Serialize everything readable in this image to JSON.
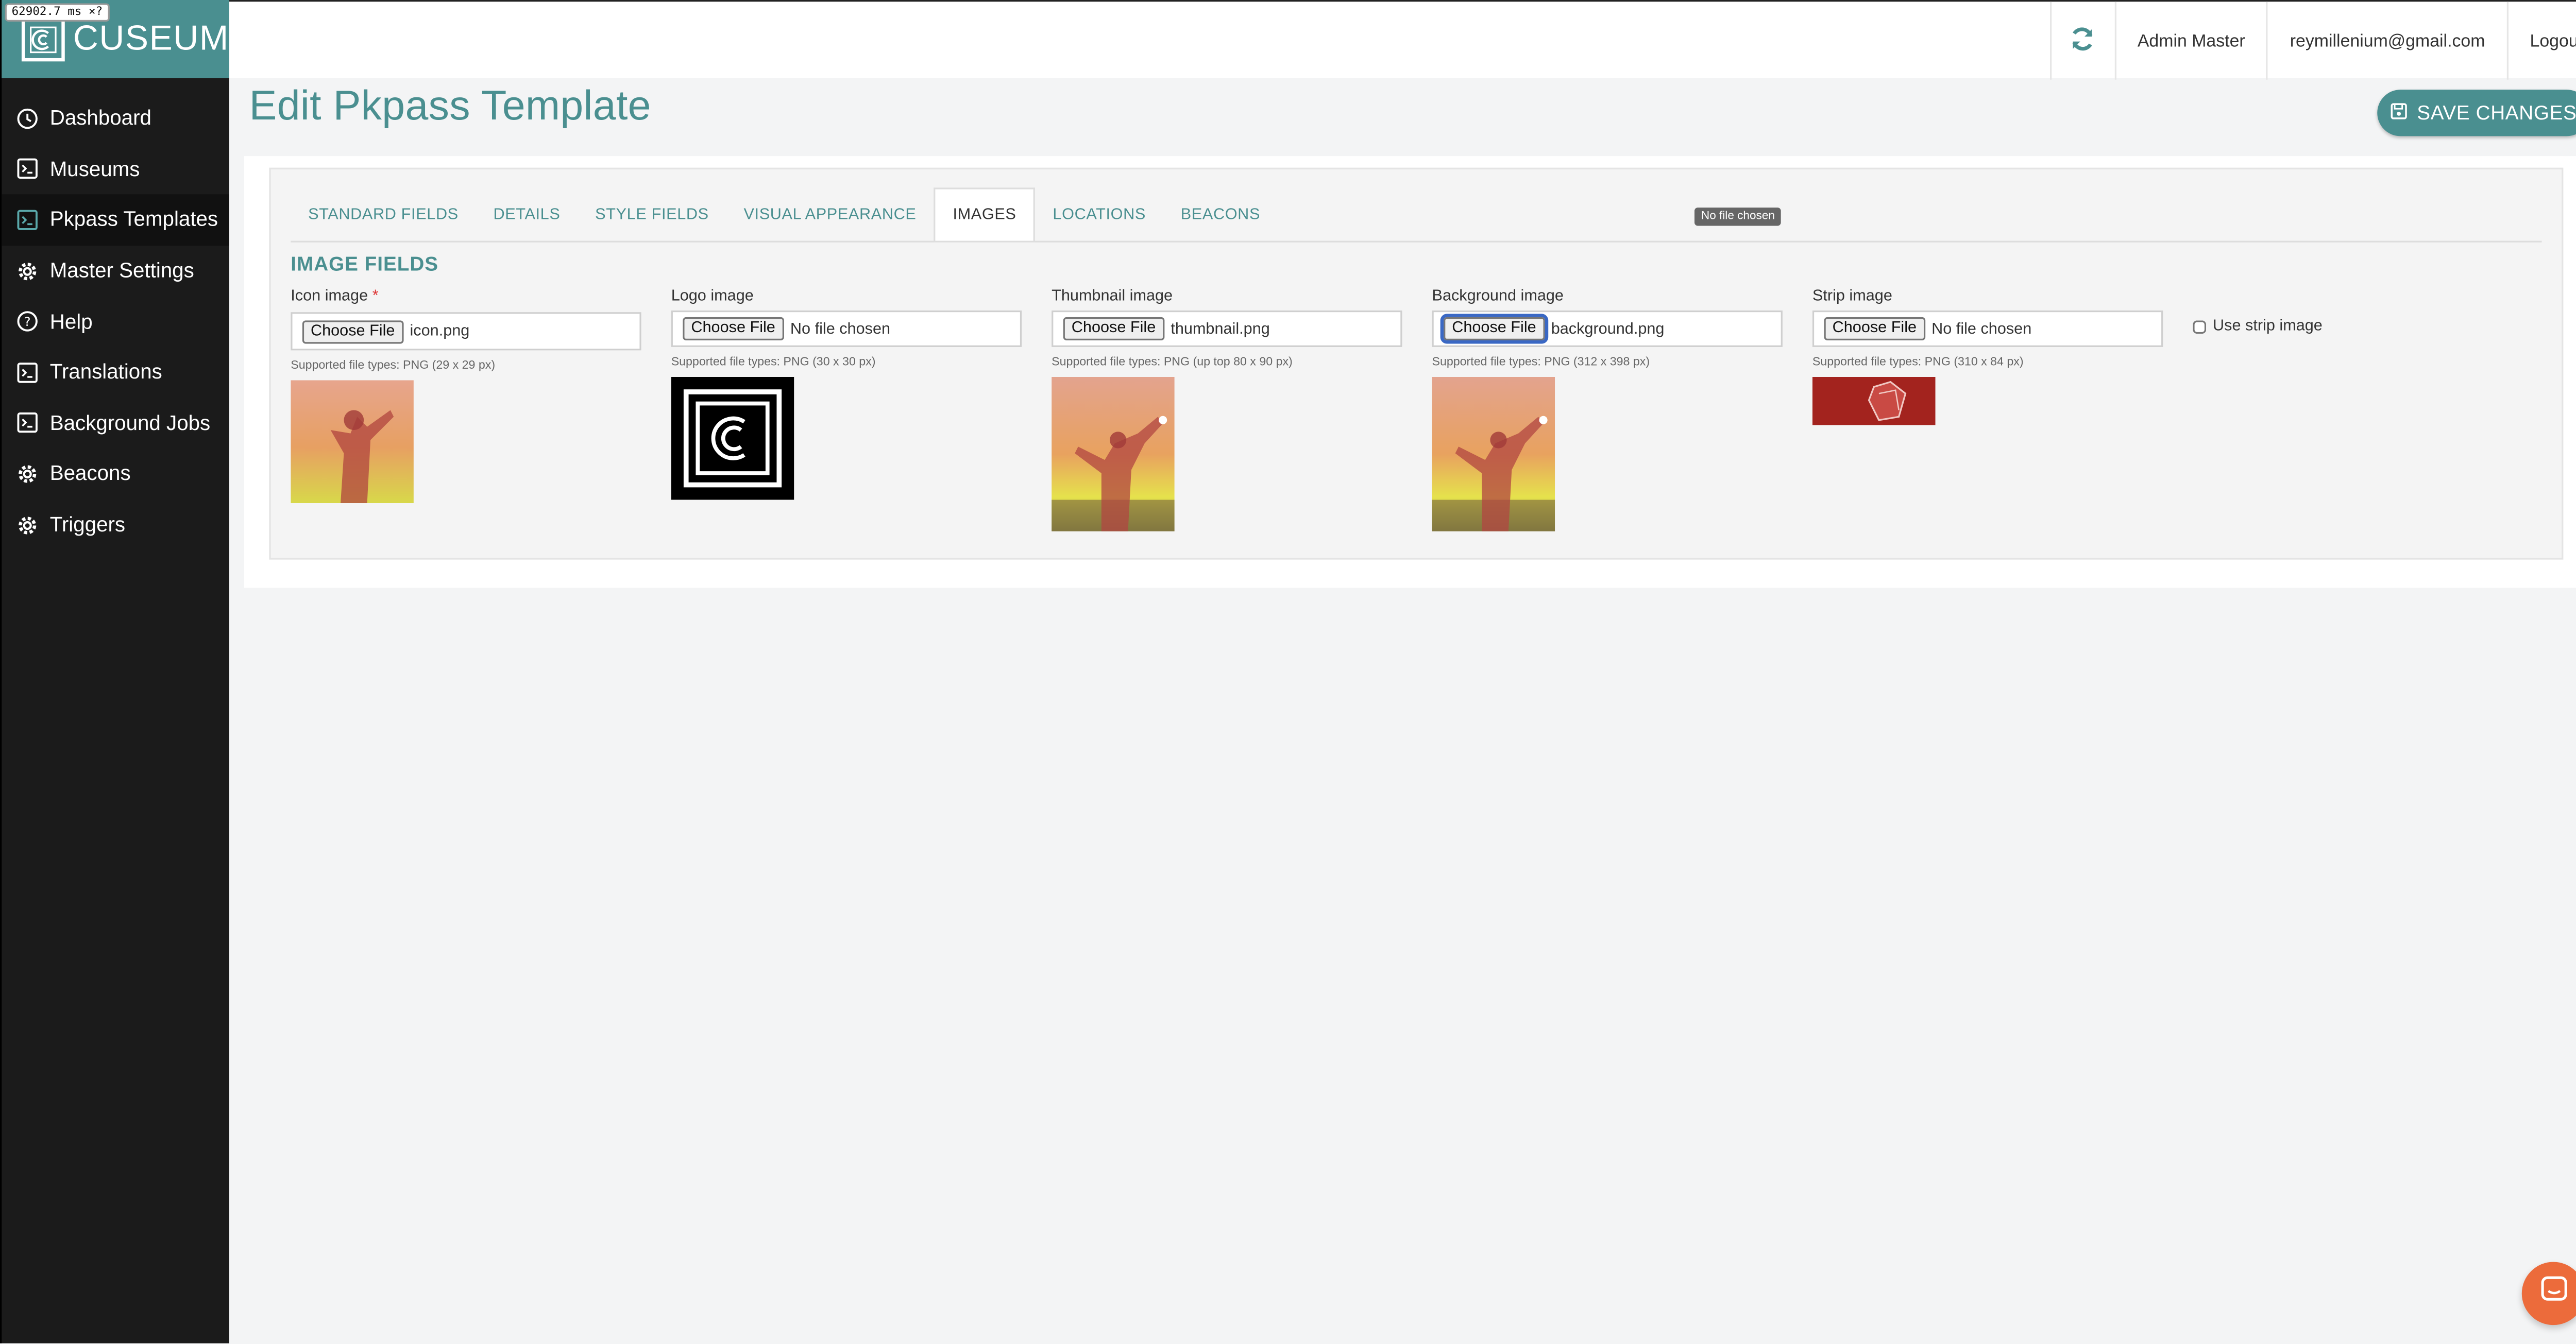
{
  "perf_badge": "62902.7 ms ×?",
  "brand": {
    "name": "CUSEUM",
    "color": "#4a8f90"
  },
  "sidebar": {
    "items": [
      {
        "label": "Dashboard",
        "icon": "clock-icon"
      },
      {
        "label": "Museums",
        "icon": "terminal-icon"
      },
      {
        "label": "Pkpass Templates",
        "icon": "terminal-icon",
        "active": true
      },
      {
        "label": "Master Settings",
        "icon": "gear-icon"
      },
      {
        "label": "Help",
        "icon": "question-icon"
      },
      {
        "label": "Translations",
        "icon": "terminal-icon"
      },
      {
        "label": "Background Jobs",
        "icon": "terminal-icon"
      },
      {
        "label": "Beacons",
        "icon": "gear-icon"
      },
      {
        "label": "Triggers",
        "icon": "gear-icon"
      }
    ]
  },
  "topbar": {
    "user_name": "Admin Master",
    "email": "reymillenium@gmail.com",
    "logout": "Logout"
  },
  "page": {
    "title": "Edit Pkpass Template",
    "save_label": "SAVE CHANGES"
  },
  "tabs": [
    {
      "label": "STANDARD FIELDS"
    },
    {
      "label": "DETAILS"
    },
    {
      "label": "STYLE FIELDS"
    },
    {
      "label": "VISUAL APPEARANCE"
    },
    {
      "label": "IMAGES",
      "active": true
    },
    {
      "label": "LOCATIONS"
    },
    {
      "label": "BEACONS"
    }
  ],
  "tooltip": "No file chosen",
  "section_title": "IMAGE FIELDS",
  "fields": {
    "icon": {
      "label": "Icon image",
      "required": "*",
      "button": "Choose File",
      "file": "icon.png",
      "hint": "Supported file types: PNG (29 x 29 px)"
    },
    "logo": {
      "label": "Logo image",
      "button": "Choose File",
      "file": "No file chosen",
      "hint": "Supported file types: PNG (30 x 30 px)"
    },
    "thumbnail": {
      "label": "Thumbnail image",
      "button": "Choose File",
      "file": "thumbnail.png",
      "hint": "Supported file types: PNG (up top 80 x 90 px)"
    },
    "background": {
      "label": "Background image",
      "button": "Choose File",
      "file": "background.png",
      "hint": "Supported file types: PNG (312 x 398 px)"
    },
    "strip": {
      "label": "Strip image",
      "button": "Choose File",
      "file": "No file chosen",
      "hint": "Supported file types: PNG (310 x 84 px)"
    }
  },
  "use_strip_label": "Use strip image"
}
